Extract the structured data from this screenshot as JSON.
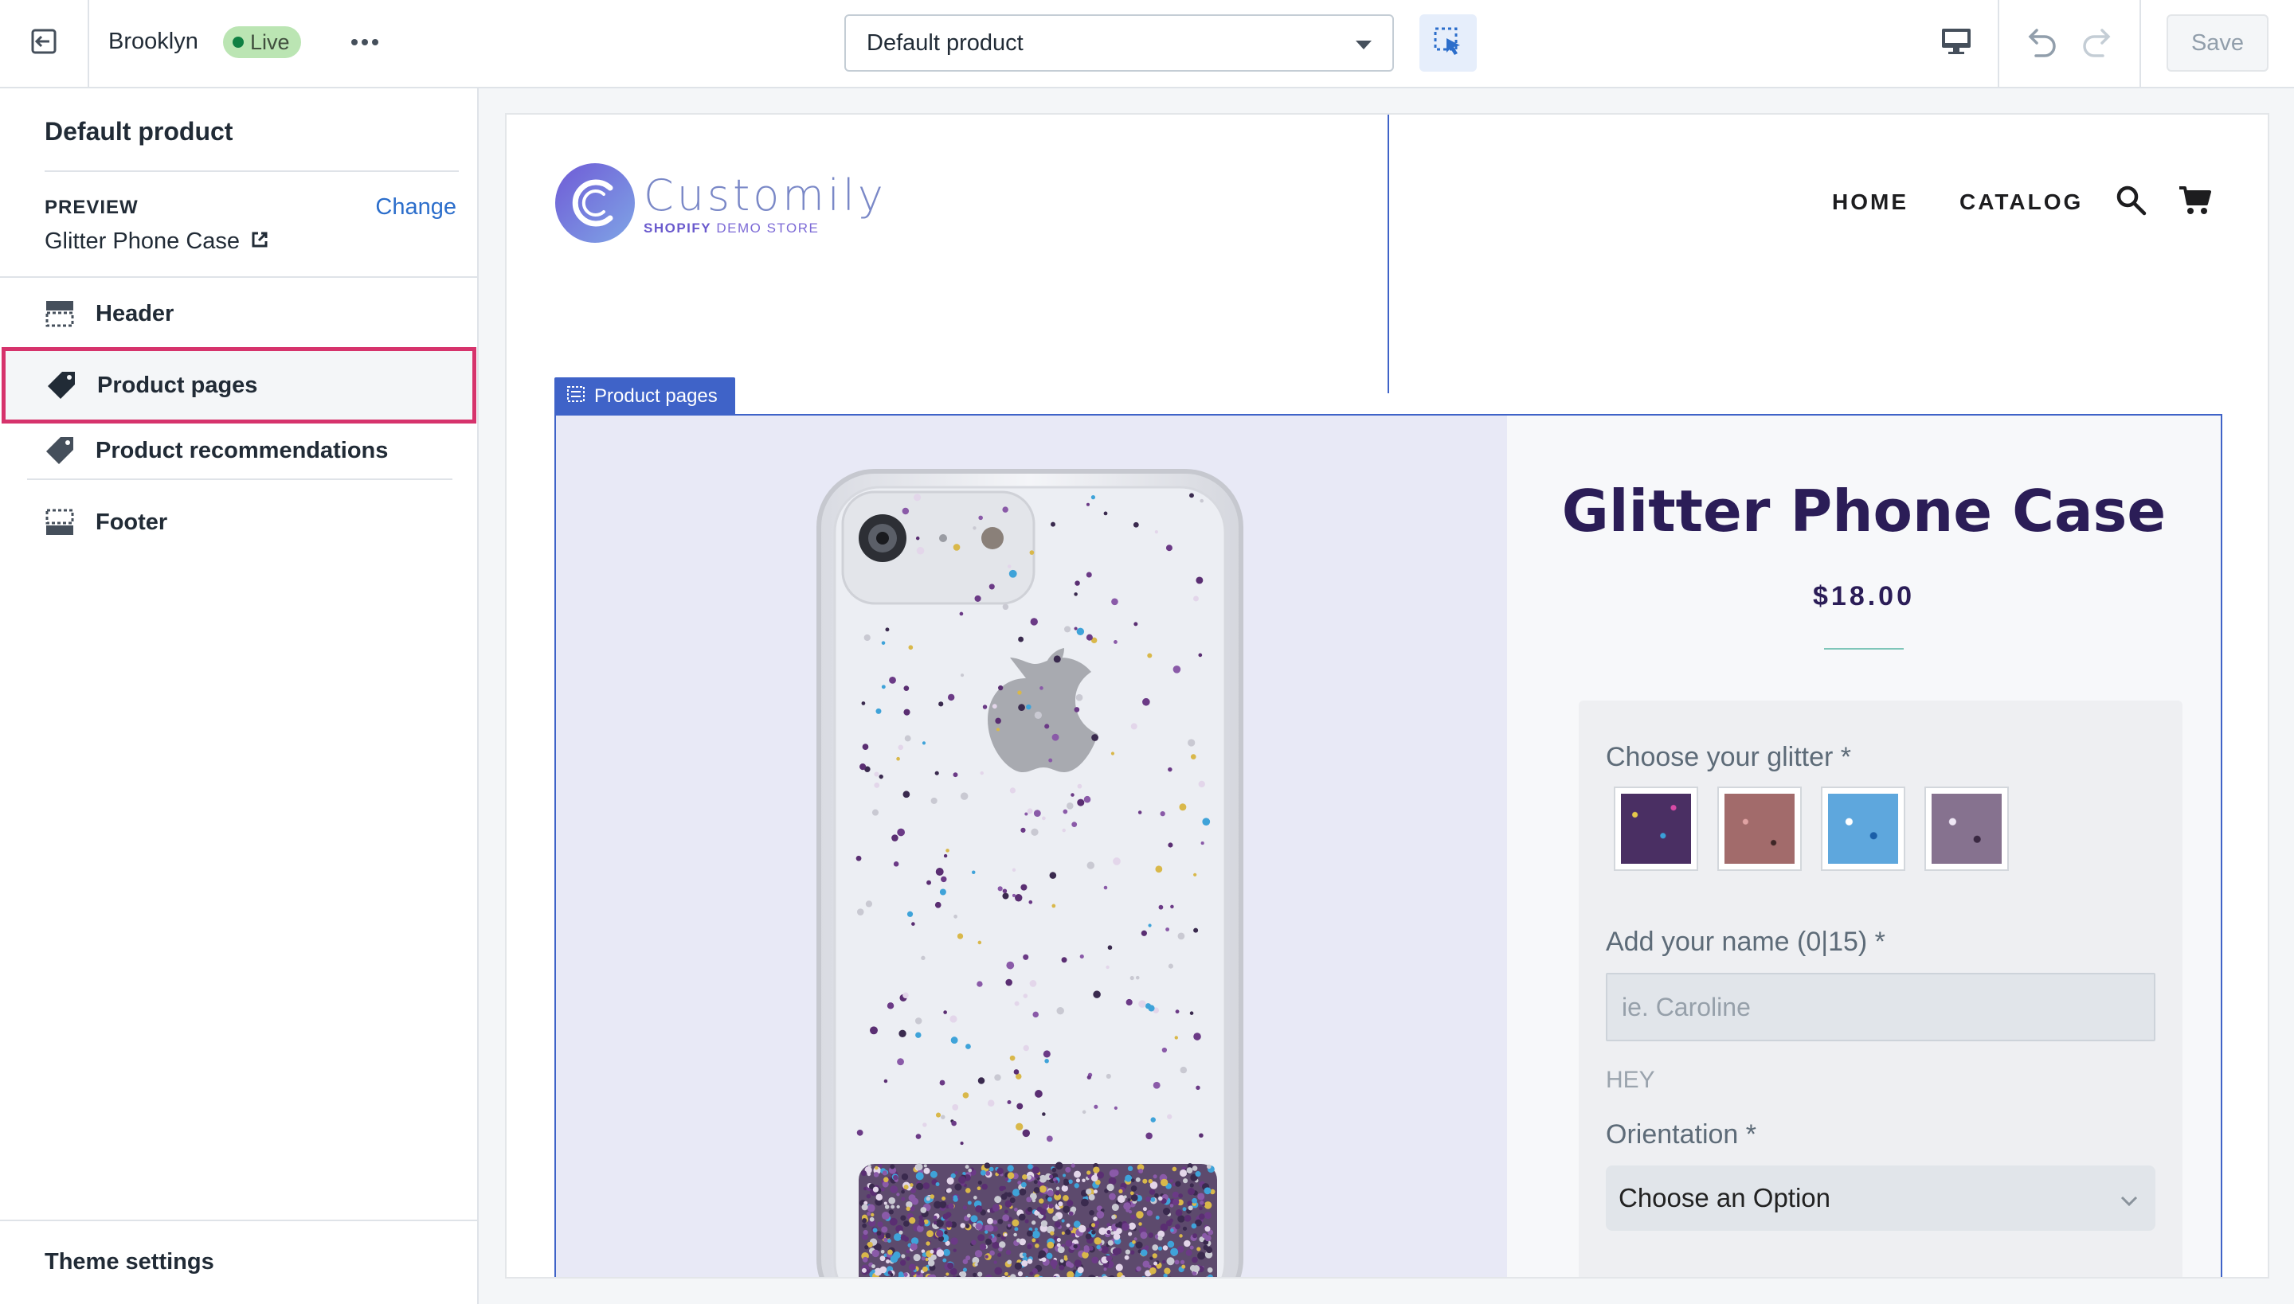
{
  "topbar": {
    "theme_name": "Brooklyn",
    "status_badge": "Live",
    "template_select_value": "Default product",
    "save_label": "Save"
  },
  "sidebar": {
    "title": "Default product",
    "preview_label": "PREVIEW",
    "change_link": "Change",
    "preview_value": "Glitter Phone Case",
    "items": [
      {
        "label": "Header",
        "icon": "header-layout-icon"
      },
      {
        "label": "Product pages",
        "icon": "tag-icon"
      },
      {
        "label": "Product recommendations",
        "icon": "tag-icon"
      },
      {
        "label": "Footer",
        "icon": "footer-layout-icon"
      }
    ],
    "theme_settings": "Theme settings"
  },
  "store": {
    "logo_text": "Customily",
    "logo_sub_bold": "SHOPIFY",
    "logo_sub_rest": "DEMO STORE",
    "nav": {
      "home": "HOME",
      "catalog": "CATALOG"
    }
  },
  "section_tag": "Product pages",
  "product": {
    "title": "Glitter Phone Case",
    "price": "$18.00",
    "option_glitter_label": "Choose your glitter *",
    "option_name_label": "Add your name (0|15) *",
    "name_placeholder": "ie. Caroline",
    "name_preview_text": "HEY",
    "option_orientation_label": "Orientation *",
    "orientation_value": "Choose an Option"
  },
  "colors": {
    "accent": "#2c6ecb",
    "highlight_border": "#d6336c",
    "section_outline": "#3f63c8",
    "live_badge_bg": "#bbe5b3",
    "product_title": "#2b1d57"
  }
}
